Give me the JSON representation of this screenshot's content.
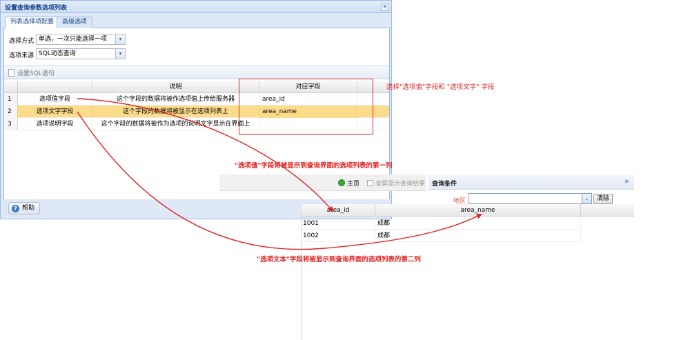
{
  "dialog": {
    "title": "设置查询参数选项列表",
    "close_icon": "×",
    "tabs": [
      {
        "label": "列表选择项配置",
        "active": true
      },
      {
        "label": "高级选项",
        "active": false
      }
    ],
    "form": {
      "select_mode_label": "选择方式",
      "select_mode_value": "单选，一次只能选择一项",
      "source_label": "选项来源",
      "source_value": "SQL动态查询"
    },
    "sql_button_label": "设置SQL语句",
    "grid": {
      "columns": [
        "说明",
        "对应字段"
      ],
      "rows": [
        {
          "num": "1",
          "field": "选项值字段",
          "desc": "这个字段的数据将被作选项值上传给服务器",
          "column": "area_id"
        },
        {
          "num": "2",
          "field": "选项文字字段",
          "desc": "这个字段的数据将被显示在选项列表上",
          "column": "area_name",
          "selected": true
        },
        {
          "num": "3",
          "field": "选项说明字段",
          "desc": "这个字段的数据将被作为选项的说明文字显示在界面上",
          "column": ""
        }
      ]
    },
    "help_button_label": "帮助"
  },
  "query_page": {
    "home_label": "主页",
    "fullscreen_label": "全屏显示查询结果",
    "conditions_title": "查询条件",
    "collapse_icon": "»",
    "region_label": "地区",
    "region_value": "",
    "clear_label": "清除",
    "result_grid": {
      "columns": [
        "area_id",
        "area_name"
      ],
      "rows": [
        {
          "area_id": "1001",
          "area_name": "成都"
        },
        {
          "area_id": "1002",
          "area_name": "成都"
        }
      ]
    }
  },
  "annotations": {
    "select_fields": "选择\"选项值\"字段和 \"选项文字\" 字段",
    "value_field_note": "\"选项值\"字段将被显示到查询界面的选项列表的第一列",
    "text_field_note": "\"选项文本\"字段将被显示到查询界面的选项列表的第二列"
  },
  "colors": {
    "annotation": "#e02020",
    "selected_row": "#fcdc8a",
    "window_border": "#99bbe8",
    "title_text": "#15428b"
  },
  "icons": {
    "close": "close-icon",
    "combo_trigger": "chevron-down-icon",
    "sql_document": "document-icon",
    "help": "help-icon",
    "home": "home-icon",
    "fullscreen": "checkbox-icon",
    "collapse": "double-chevron-right-icon"
  }
}
